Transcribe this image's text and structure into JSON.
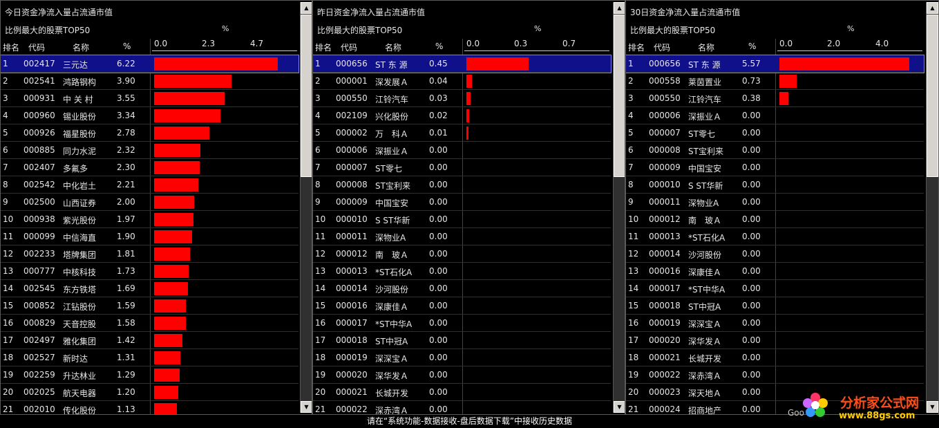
{
  "panels": [
    {
      "title": "今日资金净流入量占流通市值",
      "subtitle": "比例最大的股票TOP50",
      "pct_label": "%",
      "headers": {
        "rank": "排名",
        "code": "代码",
        "name": "名称",
        "pct": "%"
      },
      "ticks": [
        "0.0",
        "2.3",
        "4.7"
      ],
      "axis_max": 6.9,
      "selected_index": 0,
      "rows": [
        {
          "rank": "1",
          "code": "002417",
          "name": "三元达",
          "value": "6.22"
        },
        {
          "rank": "2",
          "code": "002541",
          "name": "鸿路钢构",
          "value": "3.90"
        },
        {
          "rank": "3",
          "code": "000931",
          "name": "中 关 村",
          "value": "3.55"
        },
        {
          "rank": "4",
          "code": "000960",
          "name": "锡业股份",
          "value": "3.34"
        },
        {
          "rank": "5",
          "code": "000926",
          "name": "福星股份",
          "value": "2.78"
        },
        {
          "rank": "6",
          "code": "000885",
          "name": "同力水泥",
          "value": "2.32"
        },
        {
          "rank": "7",
          "code": "002407",
          "name": "多氟多",
          "value": "2.30"
        },
        {
          "rank": "8",
          "code": "002542",
          "name": "中化岩土",
          "value": "2.21"
        },
        {
          "rank": "9",
          "code": "002500",
          "name": "山西证券",
          "value": "2.00"
        },
        {
          "rank": "10",
          "code": "000938",
          "name": "紫光股份",
          "value": "1.97"
        },
        {
          "rank": "11",
          "code": "000099",
          "name": "中信海直",
          "value": "1.90"
        },
        {
          "rank": "12",
          "code": "002233",
          "name": "塔牌集团",
          "value": "1.81"
        },
        {
          "rank": "13",
          "code": "000777",
          "name": "中核科技",
          "value": "1.73"
        },
        {
          "rank": "14",
          "code": "002545",
          "name": "东方铁塔",
          "value": "1.69"
        },
        {
          "rank": "15",
          "code": "000852",
          "name": "江钻股份",
          "value": "1.59"
        },
        {
          "rank": "16",
          "code": "000829",
          "name": "天音控股",
          "value": "1.58"
        },
        {
          "rank": "17",
          "code": "002497",
          "name": "雅化集团",
          "value": "1.42"
        },
        {
          "rank": "18",
          "code": "002527",
          "name": "新时达",
          "value": "1.31"
        },
        {
          "rank": "19",
          "code": "002259",
          "name": "升达林业",
          "value": "1.29"
        },
        {
          "rank": "20",
          "code": "002025",
          "name": "航天电器",
          "value": "1.20"
        },
        {
          "rank": "21",
          "code": "002010",
          "name": "传化股份",
          "value": "1.13"
        }
      ]
    },
    {
      "title": "昨日资金净流入量占流通市值",
      "subtitle": "比例最大的股票TOP50",
      "pct_label": "%",
      "headers": {
        "rank": "排名",
        "code": "代码",
        "name": "名称",
        "pct": "%"
      },
      "ticks": [
        "0.0",
        "0.3",
        "0.7"
      ],
      "axis_max": 1.0,
      "selected_index": 0,
      "rows": [
        {
          "rank": "1",
          "code": "000656",
          "name": "ST 东 源",
          "value": "0.45"
        },
        {
          "rank": "2",
          "code": "000001",
          "name": "深发展Ａ",
          "value": "0.04"
        },
        {
          "rank": "3",
          "code": "000550",
          "name": "江铃汽车",
          "value": "0.03"
        },
        {
          "rank": "4",
          "code": "002109",
          "name": "兴化股份",
          "value": "0.02"
        },
        {
          "rank": "5",
          "code": "000002",
          "name": "万　科Ａ",
          "value": "0.01"
        },
        {
          "rank": "6",
          "code": "000006",
          "name": "深振业Ａ",
          "value": "0.00"
        },
        {
          "rank": "7",
          "code": "000007",
          "name": "ST零七",
          "value": "0.00"
        },
        {
          "rank": "8",
          "code": "000008",
          "name": "ST宝利来",
          "value": "0.00"
        },
        {
          "rank": "9",
          "code": "000009",
          "name": "中国宝安",
          "value": "0.00"
        },
        {
          "rank": "10",
          "code": "000010",
          "name": "S ST华新",
          "value": "0.00"
        },
        {
          "rank": "11",
          "code": "000011",
          "name": "深物业A",
          "value": "0.00"
        },
        {
          "rank": "12",
          "code": "000012",
          "name": "南　玻Ａ",
          "value": "0.00"
        },
        {
          "rank": "13",
          "code": "000013",
          "name": "*ST石化A",
          "value": "0.00"
        },
        {
          "rank": "14",
          "code": "000014",
          "name": "沙河股份",
          "value": "0.00"
        },
        {
          "rank": "15",
          "code": "000016",
          "name": "深康佳Ａ",
          "value": "0.00"
        },
        {
          "rank": "16",
          "code": "000017",
          "name": "*ST中华A",
          "value": "0.00"
        },
        {
          "rank": "17",
          "code": "000018",
          "name": "ST中冠A",
          "value": "0.00"
        },
        {
          "rank": "18",
          "code": "000019",
          "name": "深深宝Ａ",
          "value": "0.00"
        },
        {
          "rank": "19",
          "code": "000020",
          "name": "深华发Ａ",
          "value": "0.00"
        },
        {
          "rank": "20",
          "code": "000021",
          "name": "长城开发",
          "value": "0.00"
        },
        {
          "rank": "21",
          "code": "000022",
          "name": "深赤湾Ａ",
          "value": "0.00"
        }
      ]
    },
    {
      "title": "30日资金净流入量占流通市值",
      "subtitle": "比例最大的股票TOP50",
      "pct_label": "%",
      "headers": {
        "rank": "排名",
        "code": "代码",
        "name": "名称",
        "pct": "%"
      },
      "ticks": [
        "0.0",
        "2.0",
        "4.0"
      ],
      "axis_max": 5.9,
      "selected_index": 0,
      "rows": [
        {
          "rank": "1",
          "code": "000656",
          "name": "ST 东 源",
          "value": "5.57"
        },
        {
          "rank": "2",
          "code": "000558",
          "name": "莱茵置业",
          "value": "0.73"
        },
        {
          "rank": "3",
          "code": "000550",
          "name": "江铃汽车",
          "value": "0.38"
        },
        {
          "rank": "4",
          "code": "000006",
          "name": "深振业Ａ",
          "value": "0.00"
        },
        {
          "rank": "5",
          "code": "000007",
          "name": "ST零七",
          "value": "0.00"
        },
        {
          "rank": "6",
          "code": "000008",
          "name": "ST宝利来",
          "value": "0.00"
        },
        {
          "rank": "7",
          "code": "000009",
          "name": "中国宝安",
          "value": "0.00"
        },
        {
          "rank": "8",
          "code": "000010",
          "name": "S ST华新",
          "value": "0.00"
        },
        {
          "rank": "9",
          "code": "000011",
          "name": "深物业A",
          "value": "0.00"
        },
        {
          "rank": "10",
          "code": "000012",
          "name": "南　玻Ａ",
          "value": "0.00"
        },
        {
          "rank": "11",
          "code": "000013",
          "name": "*ST石化A",
          "value": "0.00"
        },
        {
          "rank": "12",
          "code": "000014",
          "name": "沙河股份",
          "value": "0.00"
        },
        {
          "rank": "13",
          "code": "000016",
          "name": "深康佳Ａ",
          "value": "0.00"
        },
        {
          "rank": "14",
          "code": "000017",
          "name": "*ST中华A",
          "value": "0.00"
        },
        {
          "rank": "15",
          "code": "000018",
          "name": "ST中冠A",
          "value": "0.00"
        },
        {
          "rank": "16",
          "code": "000019",
          "name": "深深宝Ａ",
          "value": "0.00"
        },
        {
          "rank": "17",
          "code": "000020",
          "name": "深华发Ａ",
          "value": "0.00"
        },
        {
          "rank": "18",
          "code": "000021",
          "name": "长城开发",
          "value": "0.00"
        },
        {
          "rank": "19",
          "code": "000022",
          "name": "深赤湾Ａ",
          "value": "0.00"
        },
        {
          "rank": "20",
          "code": "000023",
          "name": "深天地Ａ",
          "value": "0.00"
        },
        {
          "rank": "21",
          "code": "000024",
          "name": "招商地产",
          "value": "0.00"
        }
      ]
    }
  ],
  "status_bar": "请在“系统功能-数据接收-盘后数据下载”中接收历史数据",
  "watermark": {
    "brand": "分析家公式网",
    "url": "www.88gs.com",
    "faded": "Goo"
  },
  "colors": {
    "bar": "#ff0000",
    "selected_row": "#10108a",
    "background": "#000000"
  }
}
